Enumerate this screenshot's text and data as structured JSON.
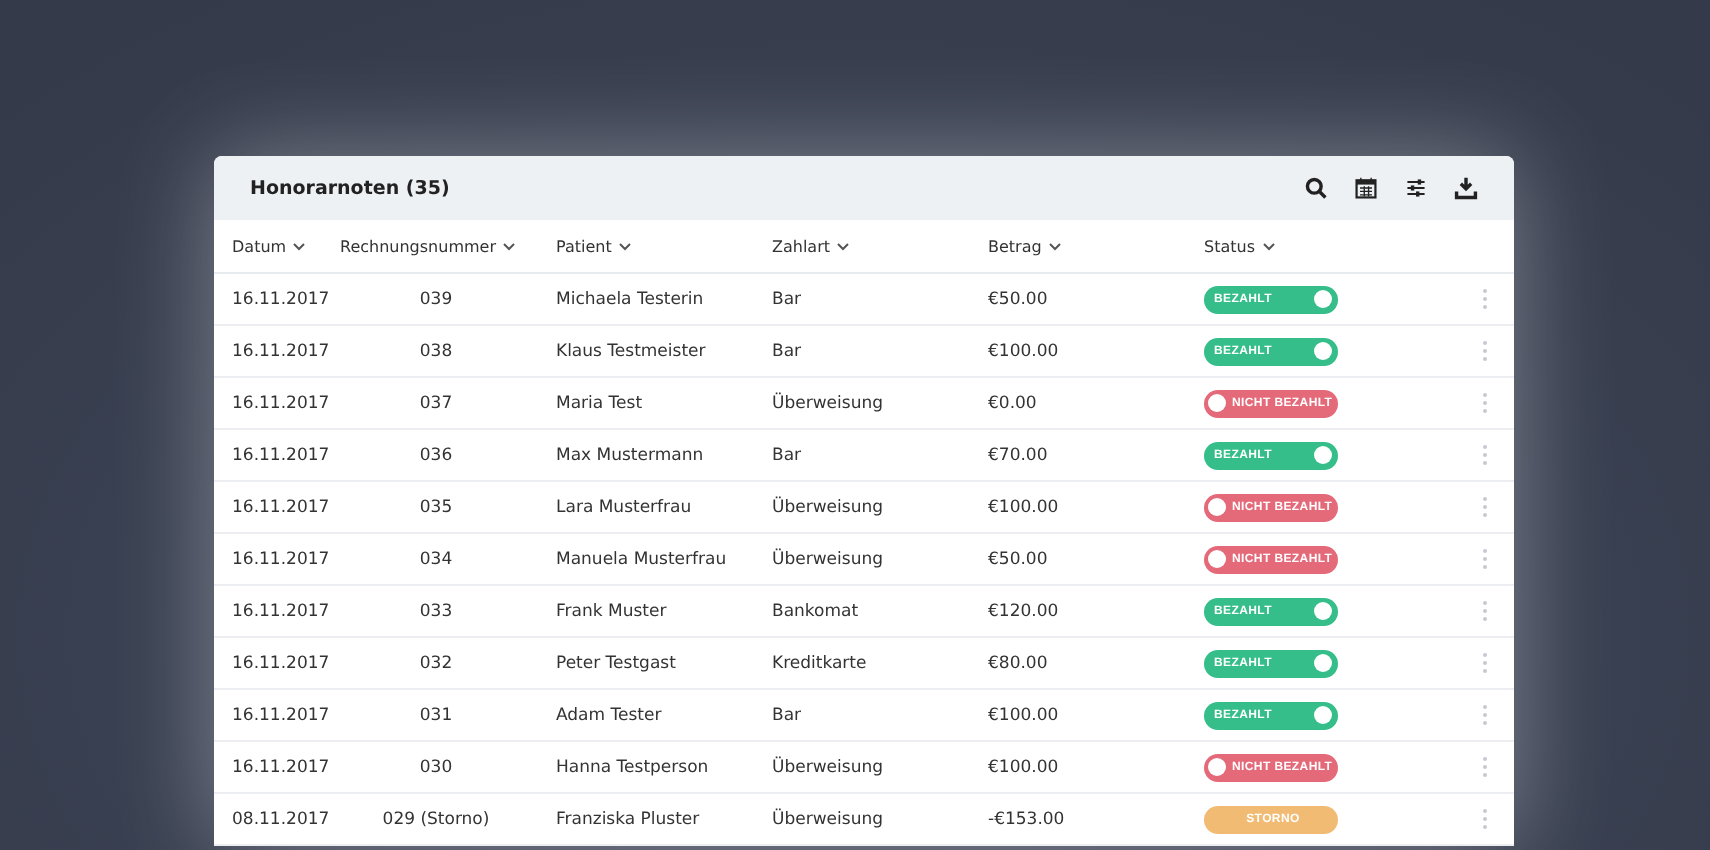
{
  "title": "Honorarnoten (35)",
  "columns": [
    {
      "label": "Datum"
    },
    {
      "label": "Rechnungsnummer"
    },
    {
      "label": "Patient"
    },
    {
      "label": "Zahlart"
    },
    {
      "label": "Betrag"
    },
    {
      "label": "Status"
    }
  ],
  "rows": [
    {
      "date": "16.11.2017",
      "number": "039",
      "patient": "Michaela Testerin",
      "payment": "Bar",
      "amount": "€50.00",
      "status": {
        "label": "BEZAHLT",
        "kind": "paid"
      }
    },
    {
      "date": "16.11.2017",
      "number": "038",
      "patient": "Klaus Testmeister",
      "payment": "Bar",
      "amount": "€100.00",
      "status": {
        "label": "BEZAHLT",
        "kind": "paid"
      }
    },
    {
      "date": "16.11.2017",
      "number": "037",
      "patient": "Maria Test",
      "payment": "Überweisung",
      "amount": "€0.00",
      "status": {
        "label": "NICHT BEZAHLT",
        "kind": "unpaid"
      }
    },
    {
      "date": "16.11.2017",
      "number": "036",
      "patient": "Max Mustermann",
      "payment": "Bar",
      "amount": "€70.00",
      "status": {
        "label": "BEZAHLT",
        "kind": "paid"
      }
    },
    {
      "date": "16.11.2017",
      "number": "035",
      "patient": "Lara Musterfrau",
      "payment": "Überweisung",
      "amount": "€100.00",
      "status": {
        "label": "NICHT BEZAHLT",
        "kind": "unpaid"
      }
    },
    {
      "date": "16.11.2017",
      "number": "034",
      "patient": "Manuela Musterfrau",
      "payment": "Überweisung",
      "amount": "€50.00",
      "status": {
        "label": "NICHT BEZAHLT",
        "kind": "unpaid"
      }
    },
    {
      "date": "16.11.2017",
      "number": "033",
      "patient": "Frank Muster",
      "payment": "Bankomat",
      "amount": "€120.00",
      "status": {
        "label": "BEZAHLT",
        "kind": "paid"
      }
    },
    {
      "date": "16.11.2017",
      "number": "032",
      "patient": "Peter Testgast",
      "payment": "Kreditkarte",
      "amount": "€80.00",
      "status": {
        "label": "BEZAHLT",
        "kind": "paid"
      }
    },
    {
      "date": "16.11.2017",
      "number": "031",
      "patient": "Adam Tester",
      "payment": "Bar",
      "amount": "€100.00",
      "status": {
        "label": "BEZAHLT",
        "kind": "paid"
      }
    },
    {
      "date": "16.11.2017",
      "number": "030",
      "patient": "Hanna Testperson",
      "payment": "Überweisung",
      "amount": "€100.00",
      "status": {
        "label": "NICHT BEZAHLT",
        "kind": "unpaid"
      }
    },
    {
      "date": "08.11.2017",
      "number": "029 (Storno)",
      "patient": "Franziska Pluster",
      "payment": "Überweisung",
      "amount": "-€153.00",
      "status": {
        "label": "STORNO",
        "kind": "storno"
      }
    }
  ]
}
